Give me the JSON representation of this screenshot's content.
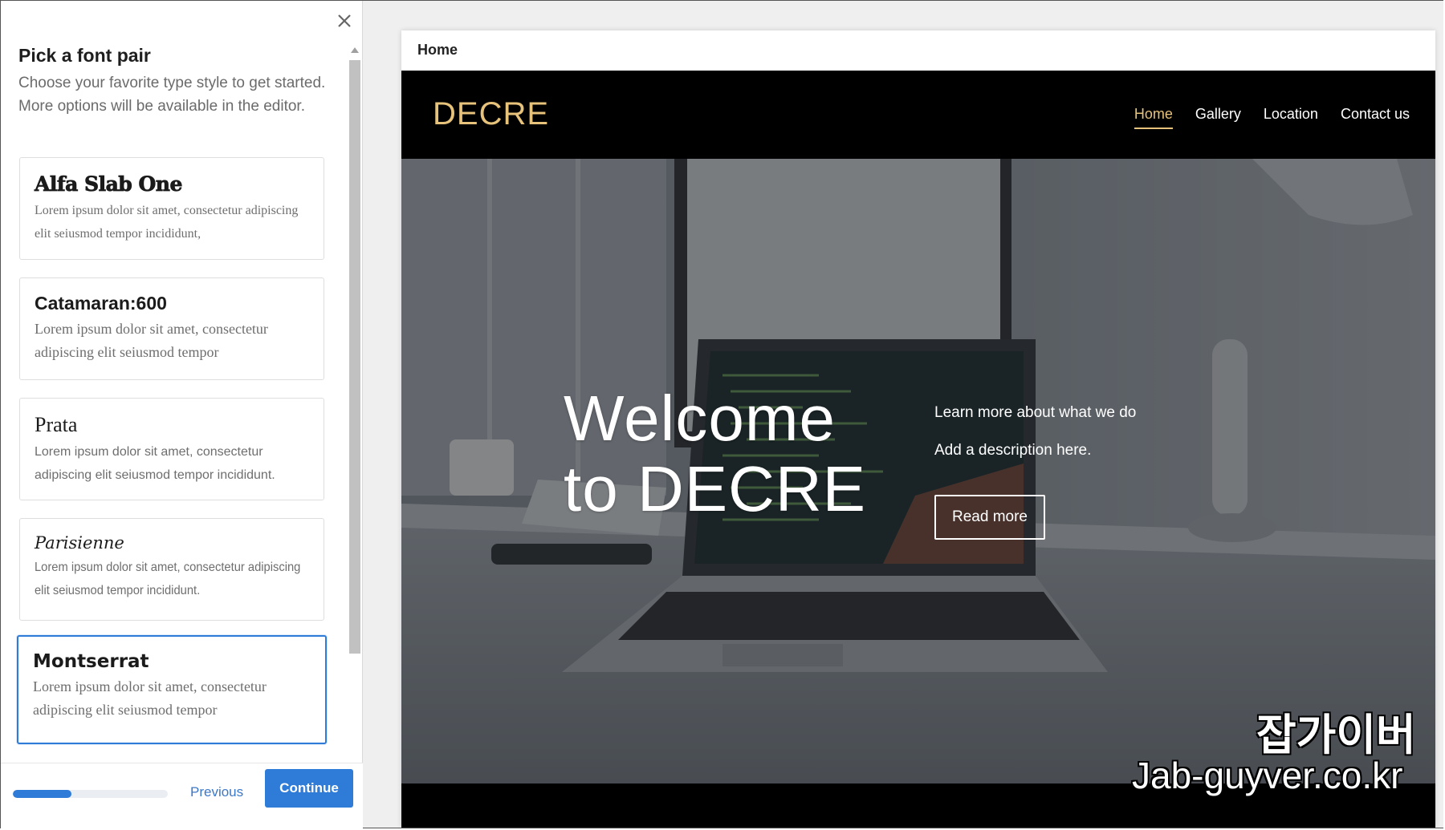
{
  "panel": {
    "title": "Pick a font pair",
    "description": "Choose your favorite type style to get started. More options will be available in the editor.",
    "fonts": [
      {
        "name": "Alfa Slab One",
        "sample": "Lorem ipsum dolor sit amet, consectetur adipiscing elit seiusmod tempor incididunt,"
      },
      {
        "name": "Catamaran:600",
        "sample": "Lorem ipsum dolor sit amet, consectetur adipiscing elit seiusmod tempor"
      },
      {
        "name": "Prata",
        "sample": "Lorem ipsum dolor sit amet, consectetur adipiscing elit seiusmod tempor incididunt."
      },
      {
        "name": "Parisienne",
        "sample": "Lorem ipsum dolor sit amet, consectetur adipiscing elit seiusmod tempor incididunt."
      },
      {
        "name": "Montserrat",
        "sample": "Lorem ipsum dolor sit amet, consectetur adipiscing elit seiusmod tempor"
      }
    ],
    "selected_font": "Montserrat",
    "progress_fraction": 0.38,
    "previous_label": "Previous",
    "continue_label": "Continue",
    "accent_color": "#2f7bd8"
  },
  "preview": {
    "page_label": "Home",
    "logo": "DECRE",
    "nav": [
      {
        "label": "Home",
        "active": true
      },
      {
        "label": "Gallery"
      },
      {
        "label": "Location"
      },
      {
        "label": "Contact us"
      }
    ],
    "hero_title_line1": "Welcome",
    "hero_title_line2": "to DECRE",
    "hero_tagline": "Learn more about what we do",
    "hero_description": "Add a description here.",
    "hero_button": "Read more",
    "brand_color": "#e6c27a"
  },
  "watermark": {
    "korean": "잡가이버",
    "url": "Jab-guyver.co.kr"
  }
}
